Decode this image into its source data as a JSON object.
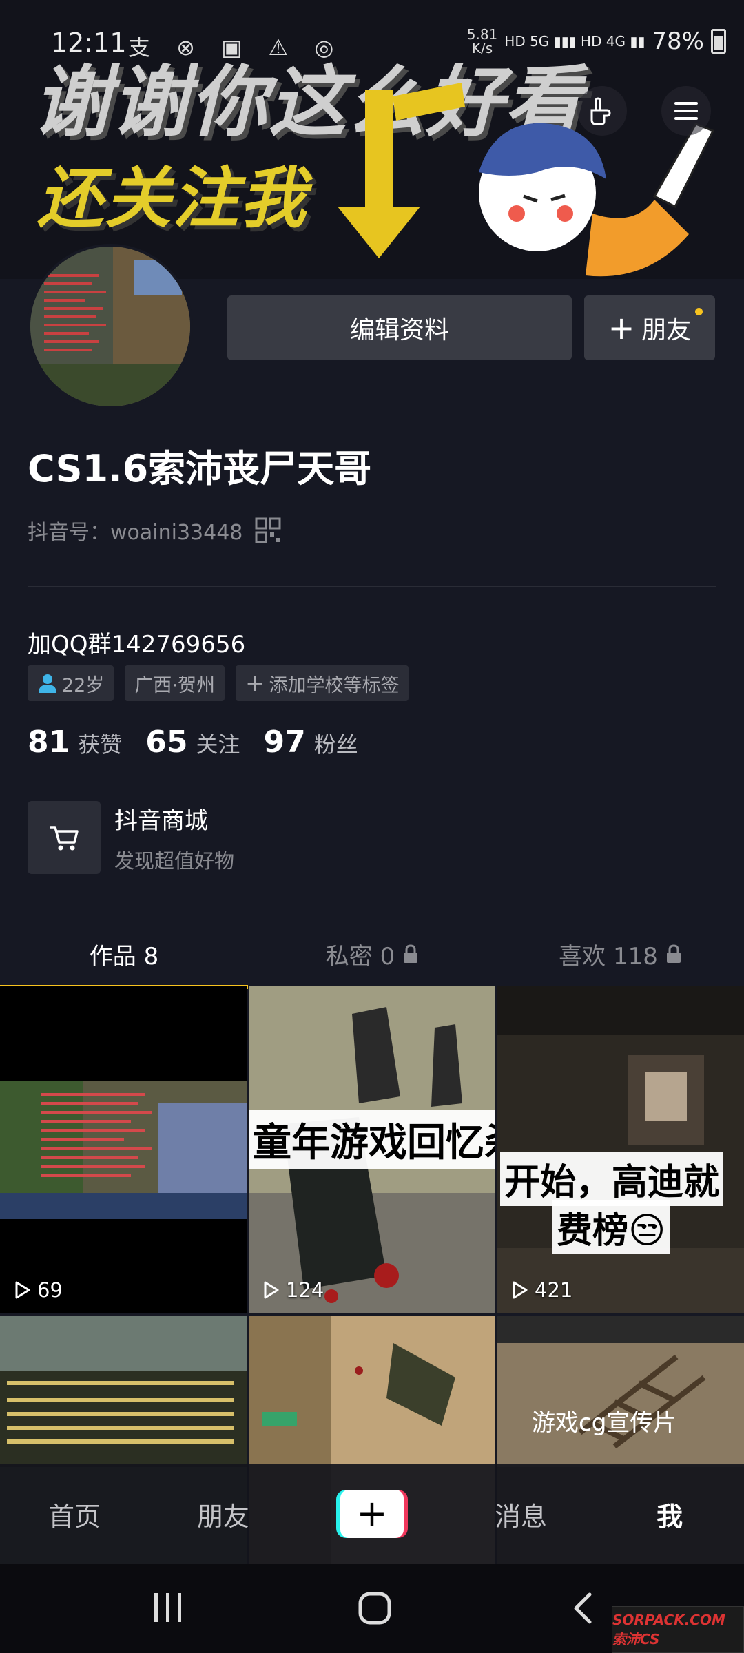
{
  "status_bar": {
    "time": "12:11",
    "icons": "支 ⊗ ▣ ⚠ ◎",
    "net_speed": "5.81",
    "net_unit": "K/s",
    "signal": "HD 5G ▮▮▮ HD 4G ▮▮",
    "battery": "78%"
  },
  "banner": {
    "line1": "谢谢你这么好看",
    "line2": "还关注我"
  },
  "profile": {
    "edit_label": "编辑资料",
    "friend_label": "朋友",
    "name": "CS1.6索沛丧尸天哥",
    "douyin_id": "抖音号：woaini33448",
    "bio": "加QQ群142769656",
    "tags": [
      "22岁",
      "广西·贺州",
      "添加学校等标签"
    ]
  },
  "stats": [
    {
      "num": "81",
      "label": "获赞"
    },
    {
      "num": "65",
      "label": "关注"
    },
    {
      "num": "97",
      "label": "粉丝"
    }
  ],
  "shop": {
    "title": "抖音商城",
    "subtitle": "发现超值好物"
  },
  "tabs": [
    {
      "label": "作品 8",
      "active": true
    },
    {
      "label": "私密 0",
      "locked": true
    },
    {
      "label": "喜欢 118",
      "locked": true
    }
  ],
  "videos": [
    {
      "plays": "69"
    },
    {
      "plays": "124",
      "caption": "童年游戏回忆杀"
    },
    {
      "plays": "421",
      "caption1": "开始，高迪就",
      "caption2": "费榜😒"
    },
    {
      "plays": ""
    },
    {
      "plays": ""
    },
    {
      "plays": "",
      "caption": "游戏cg宣传片"
    }
  ],
  "bottom_nav": {
    "home": "首页",
    "friends": "朋友",
    "create": "+",
    "messages": "消息",
    "me": "我"
  },
  "watermark": "SORPACK.COM 索沛CS",
  "colors": {
    "background": "#161823",
    "accent_yellow": "#f7c31f",
    "button_bg": "#393b44",
    "tiktok_cyan": "#28f2ed",
    "tiktok_red": "#f0375c"
  }
}
